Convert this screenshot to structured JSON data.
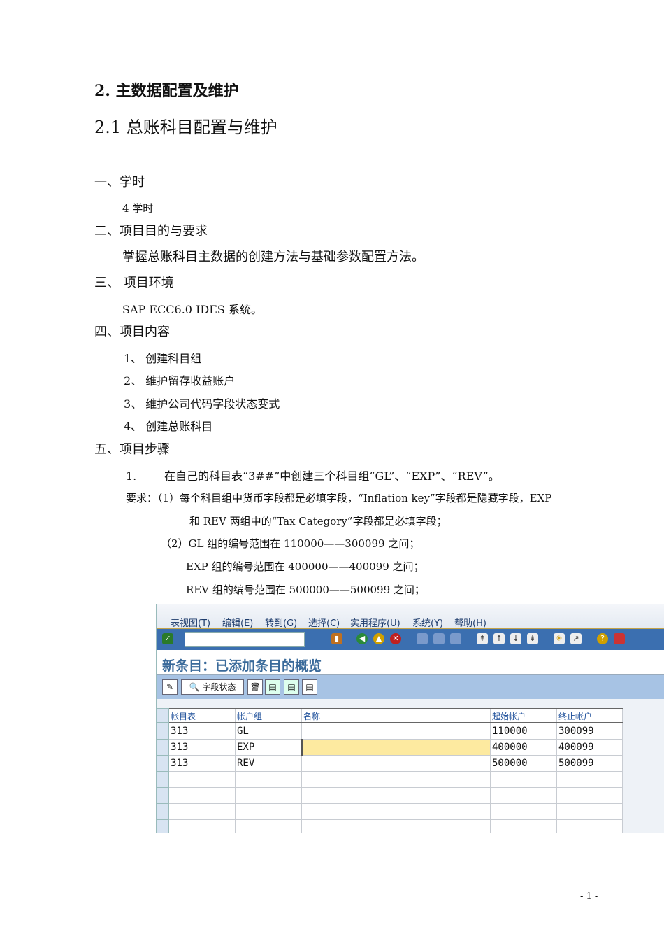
{
  "heading1": "2.  主数据配置及维护",
  "heading2": "2.1  总账科目配置与维护",
  "sections": {
    "s1": "一、学时",
    "s1_body": "4 学时",
    "s2": "二、项目目的与要求",
    "s2_body": "掌握总账科目主数据的创建方法与基础参数配置方法。",
    "s3": "三、 项目环境",
    "s3_body": "SAP ECC6.0 IDES 系统。",
    "s4": "四、项目内容",
    "s4_items": [
      "1、 创建科目组",
      "2、 维护留存收益账户",
      "3、 维护公司代码字段状态变式",
      "4、 创建总账科目"
    ],
    "s5": "五、项目步骤"
  },
  "step1": {
    "num": "1.",
    "text": "在自己的科目表“3##”中创建三个科目组“GL”、“EXP”、“REV”。"
  },
  "requirements": [
    "要求：（1）每个科目组中货币字段都是必填字段，“Inflation key”字段都是隐藏字段，EXP",
    "和 REV 两组中的“Tax Category”字段都是必填字段；",
    "（2）GL 组的编号范围在 110000——300099 之间；",
    "EXP 组的编号范围在 400000——400099 之间；",
    "REV 组的编号范围在 500000——500099 之间；"
  ],
  "sap": {
    "menu": [
      "表视图(T)",
      "编辑(E)",
      "转到(G)",
      "选择(C)",
      "实用程序(U)",
      "系统(Y)",
      "帮助(H)"
    ],
    "title": "新条目：已添加条目的概览",
    "field_status_button": "字段状态",
    "columns": [
      "帐目表",
      "帐户组",
      "名称",
      "起始帐户",
      "终止帐户"
    ],
    "rows": [
      [
        "313",
        "GL",
        "",
        "110000",
        "300099"
      ],
      [
        "313",
        "EXP",
        "",
        "400000",
        "400099"
      ],
      [
        "313",
        "REV",
        "",
        "500000",
        "500099"
      ],
      [
        "",
        "",
        "",
        "",
        ""
      ],
      [
        "",
        "",
        "",
        "",
        ""
      ],
      [
        "",
        "",
        "",
        "",
        ""
      ],
      [
        "",
        "",
        "",
        "",
        ""
      ]
    ]
  },
  "page_number": "- 1 -"
}
